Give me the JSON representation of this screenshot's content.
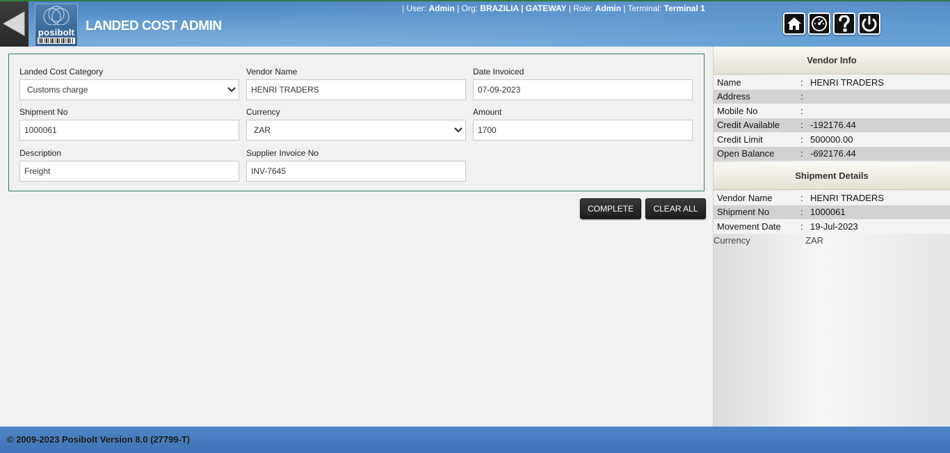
{
  "header": {
    "title": "LANDED COST ADMIN",
    "logo_text": "posibolt",
    "session": {
      "user_label": "| User:",
      "user": "Admin",
      "org_label": "| Org:",
      "org": "BRAZILIA | GATEWAY",
      "role_label": "| Role:",
      "role": "Admin",
      "terminal_label": "| Terminal:",
      "terminal": "Terminal 1"
    },
    "icons": [
      "back-arrow-icon",
      "home-icon",
      "dashboard-icon",
      "help-icon",
      "power-icon"
    ]
  },
  "form": {
    "landed_cost_category": {
      "label": "Landed Cost Category",
      "value": "Customs charge"
    },
    "vendor_name": {
      "label": "Vendor Name",
      "value": "HENRI TRADERS"
    },
    "date_invoiced": {
      "label": "Date Invoiced",
      "value": "07-09-2023"
    },
    "shipment_no": {
      "label": "Shipment No",
      "value": "1000061"
    },
    "currency": {
      "label": "Currency",
      "value": "ZAR"
    },
    "amount": {
      "label": "Amount",
      "value": "1700"
    },
    "description": {
      "label": "Description",
      "value": "Freight"
    },
    "supplier_invoice_no": {
      "label": "Supplier Invoice No",
      "value": "INV-7645"
    }
  },
  "buttons": {
    "complete": "COMPLETE",
    "clear_all": "CLEAR ALL"
  },
  "vendor_info": {
    "title": "Vendor Info",
    "rows": [
      {
        "key": "Name",
        "sep": ":",
        "value": "HENRI TRADERS"
      },
      {
        "key": "Address",
        "sep": ":",
        "value": ""
      },
      {
        "key": "Mobile No",
        "sep": ":",
        "value": ""
      },
      {
        "key": "Credit Available",
        "sep": ":",
        "value": "-192176.44"
      },
      {
        "key": "Credit Limit",
        "sep": ":",
        "value": "500000.00"
      },
      {
        "key": "Open Balance",
        "sep": ":",
        "value": "-692176.44"
      }
    ]
  },
  "shipment_details": {
    "title": "Shipment Details",
    "rows": [
      {
        "key": "Vendor Name",
        "sep": ":",
        "value": "HENRI TRADERS"
      },
      {
        "key": "Shipment No",
        "sep": ":",
        "value": "1000061"
      },
      {
        "key": "Movement Date",
        "sep": ":",
        "value": "19-Jul-2023"
      }
    ],
    "currency": {
      "key": "Currency",
      "value": "ZAR"
    }
  },
  "footer": {
    "text": "© 2009-2023 Posibolt Version 8.0 (27799-T)"
  },
  "colors": {
    "header_blue": "#5c97cf",
    "footer_blue": "#4f86c6",
    "panel_border": "#2f7a55",
    "button_dark": "#1e1e1e"
  }
}
